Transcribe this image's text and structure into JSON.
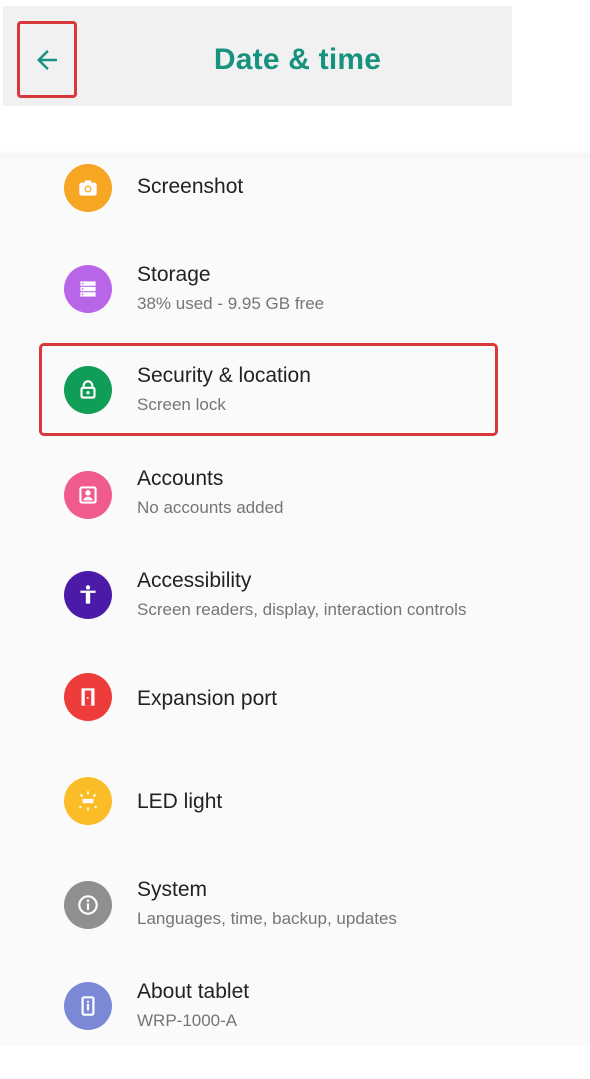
{
  "header": {
    "title": "Date & time",
    "back_icon": "arrow-left-icon",
    "title_color": "#17927e"
  },
  "highlight_color": "#d9383a",
  "settings": [
    {
      "label": "Screenshot",
      "sub": "",
      "icon": "camera-icon",
      "color": "#f6a623"
    },
    {
      "label": "Storage",
      "sub": "38% used - 9.95 GB free",
      "icon": "storage-icon",
      "color": "#b866e8"
    },
    {
      "label": "Security & location",
      "sub": "Screen lock",
      "icon": "lock-icon",
      "color": "#0f9d58"
    },
    {
      "label": "Accounts",
      "sub": "No accounts added",
      "icon": "account-icon",
      "color": "#ef5b8f"
    },
    {
      "label": "Accessibility",
      "sub": "Screen readers, display, interaction controls",
      "icon": "accessibility-icon",
      "color": "#4b1aa8"
    },
    {
      "label": "Expansion port",
      "sub": "",
      "icon": "door-icon",
      "color": "#ee3b3b"
    },
    {
      "label": "LED light",
      "sub": "",
      "icon": "light-icon",
      "color": "#fbbd27"
    },
    {
      "label": "System",
      "sub": "Languages, time, backup, updates",
      "icon": "info-icon",
      "color": "#8f8f8f"
    },
    {
      "label": "About tablet",
      "sub": "WRP-1000-A",
      "icon": "tablet-icon",
      "color": "#7b88d6"
    }
  ]
}
